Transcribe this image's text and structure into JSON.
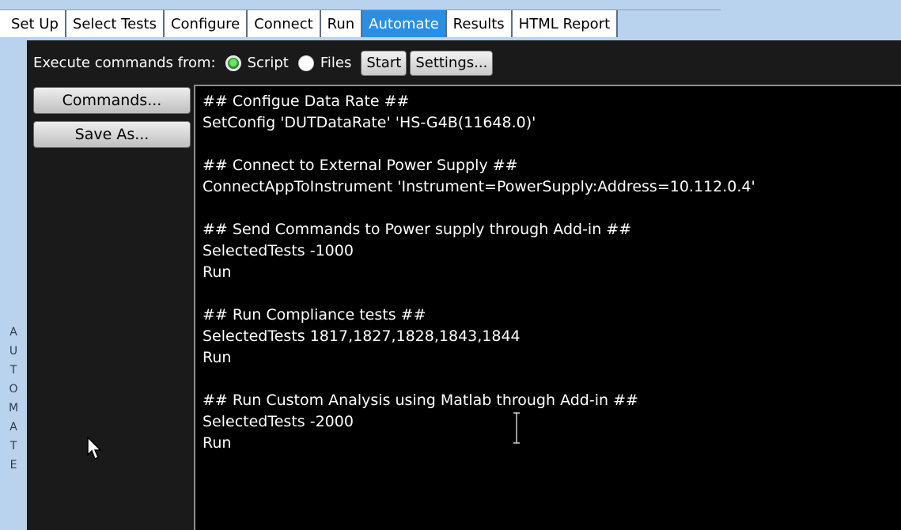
{
  "tabs": [
    {
      "label": "Set Up",
      "active": false
    },
    {
      "label": "Select Tests",
      "active": false
    },
    {
      "label": "Configure",
      "active": false
    },
    {
      "label": "Connect",
      "active": false
    },
    {
      "label": "Run",
      "active": false
    },
    {
      "label": "Automate",
      "active": true
    },
    {
      "label": "Results",
      "active": false
    },
    {
      "label": "HTML Report",
      "active": false
    }
  ],
  "side_label": "AUTOMATE",
  "toolbar": {
    "execute_label": "Execute commands from:",
    "script_option": "Script",
    "files_option": "Files",
    "selected_option": "Script",
    "start_button": "Start",
    "settings_button": "Settings..."
  },
  "side_buttons": {
    "commands": "Commands...",
    "save_as": "Save As..."
  },
  "script_lines": [
    "## Configue Data Rate ##",
    "SetConfig 'DUTDataRate' 'HS-G4B(11648.0)'",
    "",
    "## Connect to External Power Supply ##",
    "ConnectAppToInstrument 'Instrument=PowerSupply:Address=10.112.0.4'",
    "",
    "## Send Commands to Power supply through Add-in ##",
    "SelectedTests -1000",
    "Run",
    "",
    "## Run Compliance tests ##",
    "SelectedTests 1817,1827,1828,1843,1844",
    "Run",
    "",
    "## Run Custom Analysis using Matlab through Add-in ##",
    "SelectedTests -2000",
    "Run"
  ],
  "colors": {
    "active_tab": "#2a8fe4",
    "frame": "#b9d3ee",
    "editor_bg": "#000000"
  }
}
